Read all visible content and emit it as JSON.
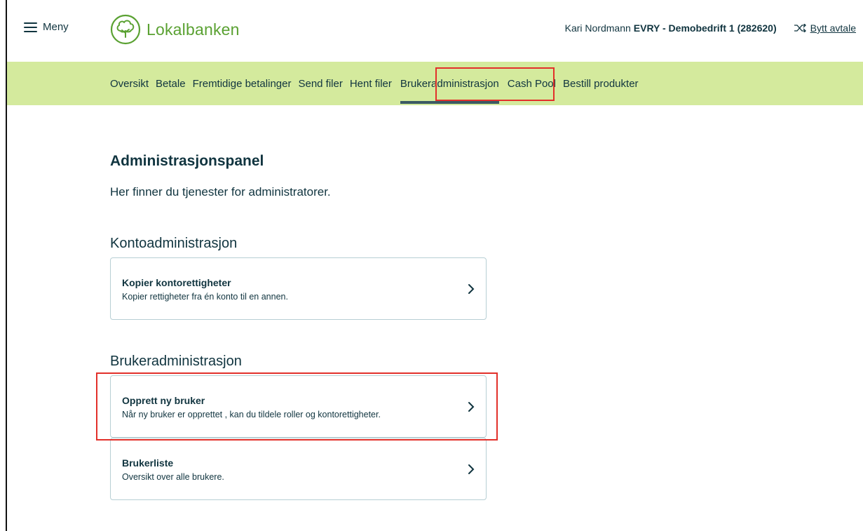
{
  "header": {
    "menu_label": "Meny",
    "logo_text": "Lokalbanken",
    "user_name": "Kari Nordmann",
    "company": "EVRY - Demobedrift 1 (282620)",
    "switch_label": "Bytt avtale"
  },
  "nav": {
    "items": [
      {
        "label": "Oversikt"
      },
      {
        "label": "Betale"
      },
      {
        "label": "Fremtidige betalinger"
      },
      {
        "label": "Send filer"
      },
      {
        "label": "Hent filer"
      },
      {
        "label": "Brukeradministrasjon"
      },
      {
        "label": "Cash Pool"
      },
      {
        "label": "Bestill produkter"
      }
    ],
    "active_index": 5
  },
  "main": {
    "title": "Administrasjonspanel",
    "description": "Her finner du tjenester for administratorer.",
    "sections": [
      {
        "title": "Kontoadministrasjon",
        "cards": [
          {
            "title": "Kopier kontorettigheter",
            "subtitle": "Kopier rettigheter fra én konto til en annen."
          }
        ]
      },
      {
        "title": "Brukeradministrasjon",
        "cards": [
          {
            "title": "Opprett ny bruker",
            "subtitle": "Når ny bruker er opprettet , kan du tildele roller og kontorettigheter."
          },
          {
            "title": "Brukerliste",
            "subtitle": "Oversikt over alle brukere."
          }
        ]
      }
    ]
  },
  "colors": {
    "brand_green": "#5aa132",
    "nav_background": "#d4ea9d",
    "text_dark": "#10343f",
    "highlight_red": "#e2302a"
  },
  "icons": {
    "menu": "hamburger-icon",
    "logo": "tree-icon",
    "switch": "shuffle-icon",
    "card_arrow": "chevron-right-icon"
  }
}
